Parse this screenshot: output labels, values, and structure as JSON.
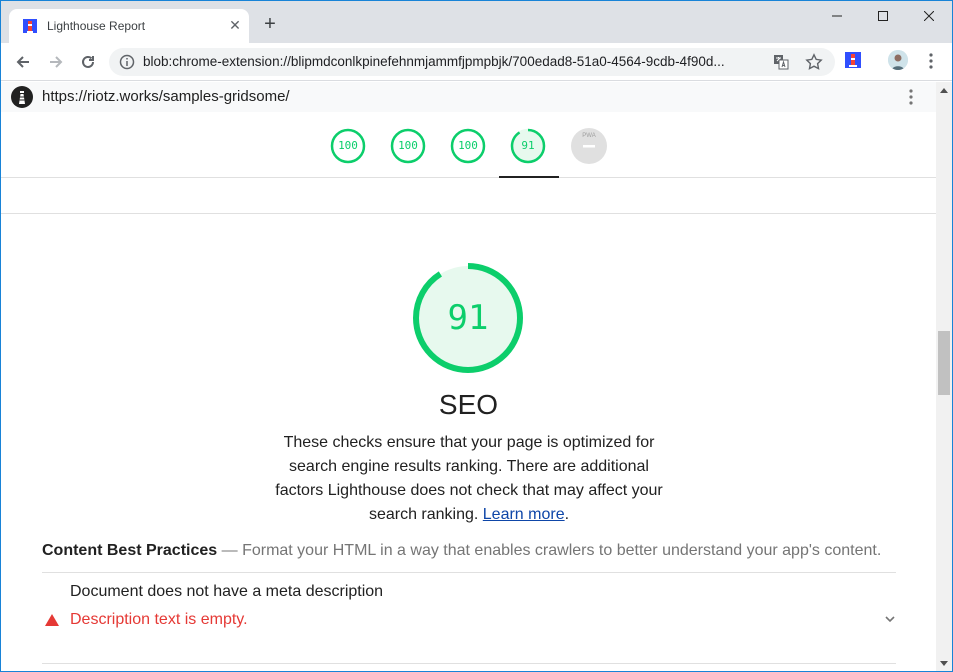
{
  "browser": {
    "tab_title": "Lighthouse Report",
    "tab_close_glyph": "✕",
    "new_tab_glyph": "+",
    "address_url": "blob:chrome-extension://blipmdconlkpinefehnmjammfjpmpbjk/700edad8-51a0-4564-9cdb-4f90d..."
  },
  "report": {
    "url": "https://riotz.works/samples-gridsome/",
    "gauges": [
      {
        "label": "100"
      },
      {
        "label": "100"
      },
      {
        "label": "100"
      },
      {
        "label": "91"
      }
    ],
    "pwa_label": "PWA",
    "category": {
      "score": "91",
      "title": "SEO",
      "description": "These checks ensure that your page is optimized for search engine results ranking. There are additional factors Lighthouse does not check that may affect your search ranking.",
      "learn_more": "Learn more",
      "learn_more_suffix": "."
    },
    "group": {
      "title": "Content Best Practices",
      "separator": " — ",
      "description": "Format your HTML in a way that enables crawlers to better understand your app's content."
    },
    "audit": {
      "title": "Document does not have a meta description",
      "explanation": "Description text is empty."
    }
  },
  "colors": {
    "pass": "#0cce6b",
    "fail": "#e53935",
    "link": "#0e46a8"
  }
}
